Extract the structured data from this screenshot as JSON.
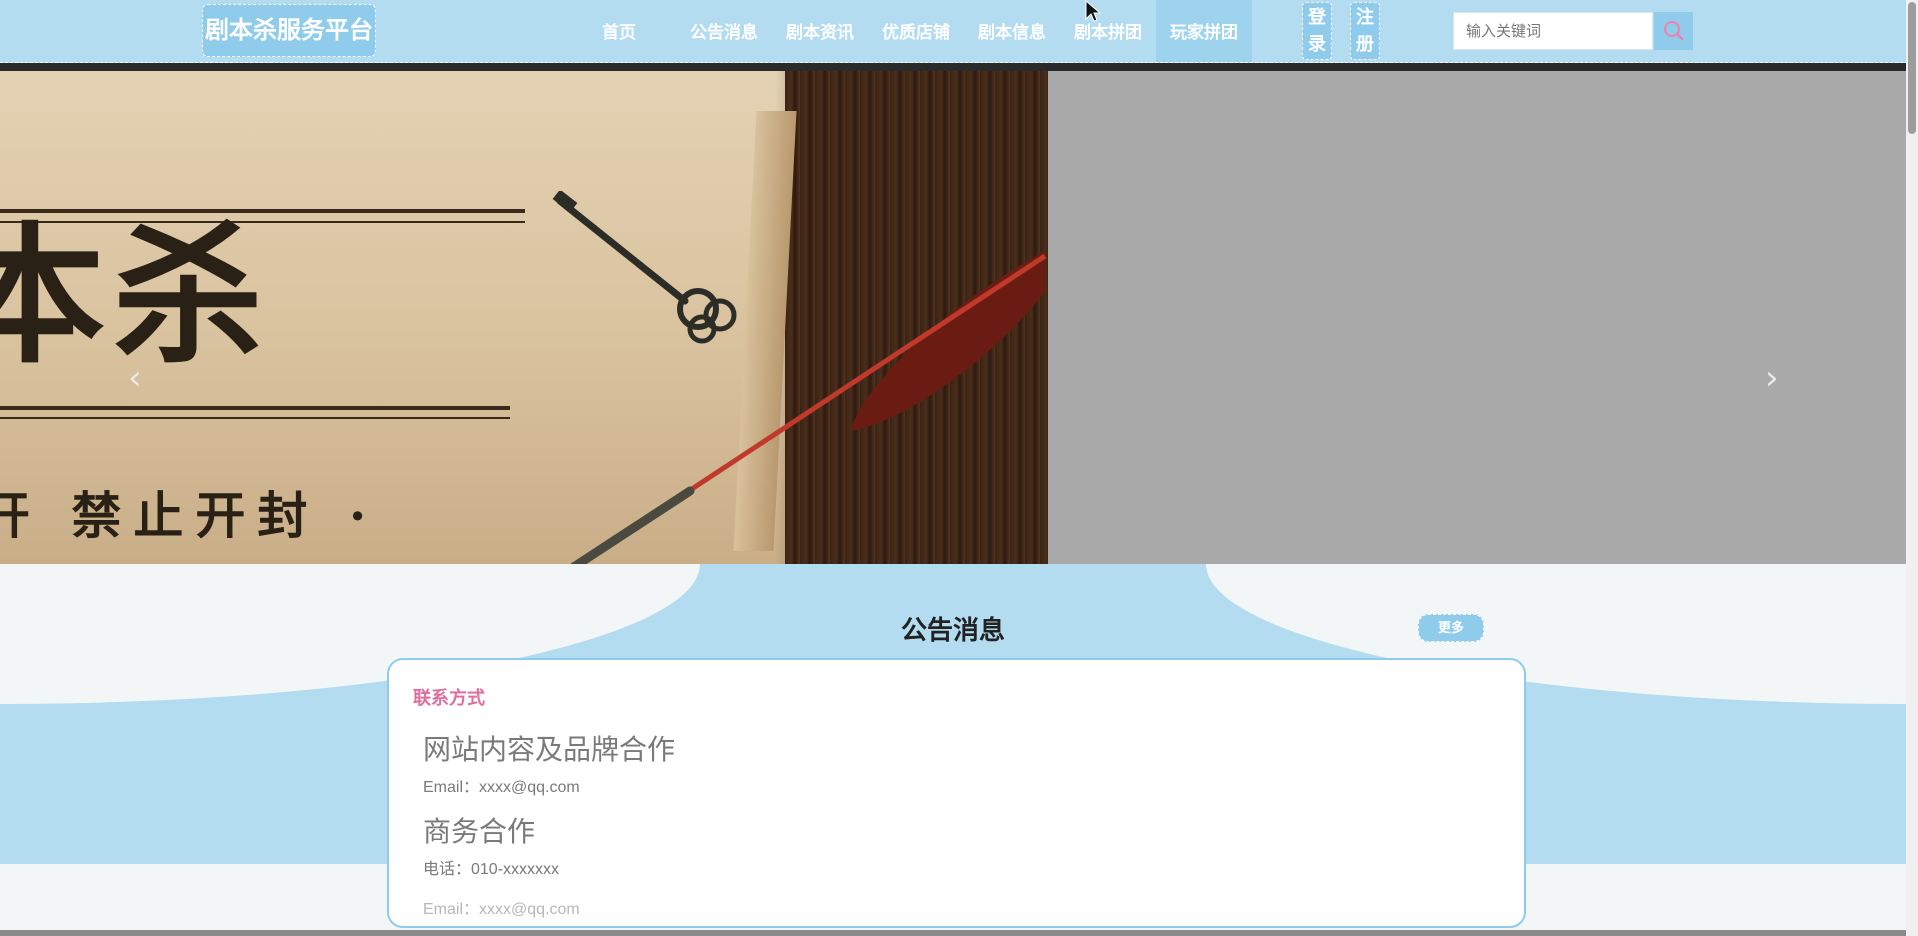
{
  "header": {
    "logo": "剧本杀服务平台",
    "nav": [
      {
        "label": "首页"
      },
      {
        "label": "公告消息"
      },
      {
        "label": "剧本资讯"
      },
      {
        "label": "优质店铺"
      },
      {
        "label": "剧本信息"
      },
      {
        "label": "剧本拼团"
      },
      {
        "label": "玩家拼团",
        "active": true
      }
    ],
    "login_label": "登录",
    "register_label": "注册",
    "search": {
      "placeholder": "输入关键词",
      "value": ""
    }
  },
  "banner": {
    "title_text": "本杀",
    "sub_text": "开  禁止开封 ·",
    "prev_icon": "chevron-left-icon",
    "next_icon": "chevron-right-icon",
    "slide_count": 3,
    "active_slide": 3
  },
  "notice": {
    "title": "公告消息",
    "more_label": "更多",
    "card": {
      "heading": "联系方式",
      "items": [
        {
          "title": "网站内容及品牌合作",
          "line": "Email：xxxx@qq.com"
        },
        {
          "title": "商务合作",
          "line": "电话：010-xxxxxxx"
        }
      ],
      "trailing_line": "Email：xxxx@qq.com"
    }
  },
  "colors": {
    "primary": "#8fccec",
    "header_bg": "#b3dcf0",
    "accent_pink": "#e06fa0"
  },
  "icons": {
    "search": "search-icon"
  }
}
